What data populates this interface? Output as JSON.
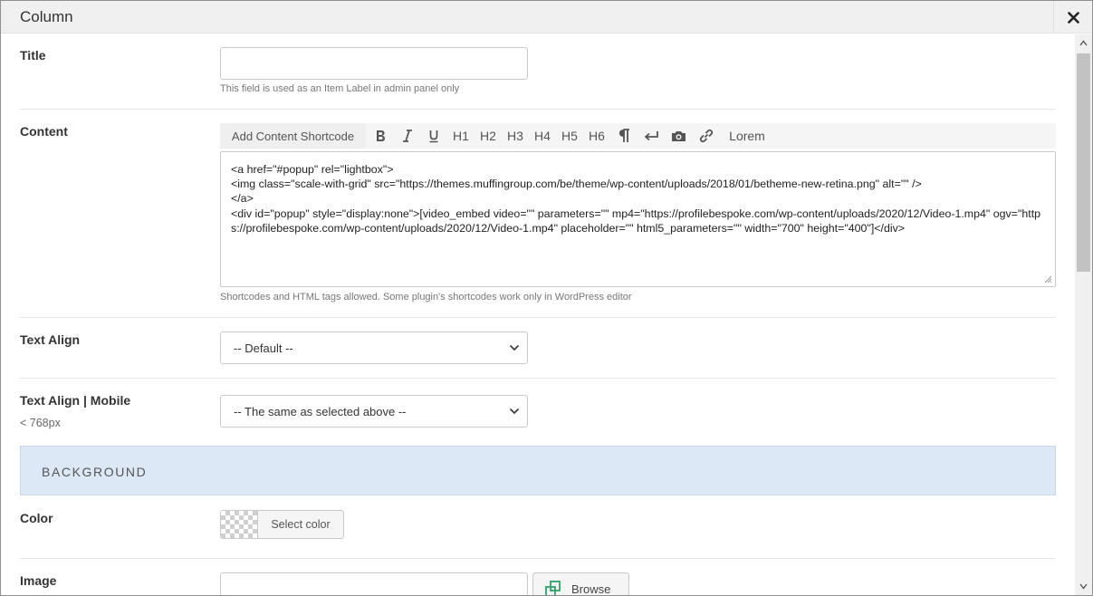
{
  "window": {
    "title": "Column",
    "close_icon": "close-icon"
  },
  "fields": {
    "title": {
      "label": "Title",
      "value": "",
      "description": "This field is used as an Item Label in admin panel only"
    },
    "content": {
      "label": "Content",
      "toolbar": {
        "shortcode": "Add Content Shortcode",
        "h1": "H1",
        "h2": "H2",
        "h3": "H3",
        "h4": "H4",
        "h5": "H5",
        "h6": "H6",
        "lorem": "Lorem"
      },
      "value": "<a href=\"#popup\" rel=\"lightbox\">\n<img class=\"scale-with-grid\" src=\"https://themes.muffingroup.com/be/theme/wp-content/uploads/2018/01/betheme-new-retina.png\" alt=\"\" />\n</a>\n<div id=\"popup\" style=\"display:none\">[video_embed video=\"\" parameters=\"\" mp4=\"https://profilebespoke.com/wp-content/uploads/2020/12/Video-1.mp4\" ogv=\"https://profilebespoke.com/wp-content/uploads/2020/12/Video-1.mp4\" placeholder=\"\" html5_parameters=\"\" width=\"700\" height=\"400\"]</div>",
      "description": "Shortcodes and HTML tags allowed. Some plugin's shortcodes work only in WordPress editor"
    },
    "text_align": {
      "label": "Text Align",
      "selected": "-- Default --"
    },
    "text_align_mobile": {
      "label": "Text Align | Mobile",
      "sublabel": "< 768px",
      "selected": "-- The same as selected above --"
    },
    "background_section": {
      "heading": "BACKGROUND"
    },
    "color": {
      "label": "Color",
      "button": "Select color"
    },
    "image": {
      "label": "Image",
      "value": "",
      "browse": "Browse"
    }
  },
  "colors": {
    "section_bg": "#dde8f6",
    "header_bg": "#f0f0f0",
    "browse_icon": "#2fa16a"
  }
}
